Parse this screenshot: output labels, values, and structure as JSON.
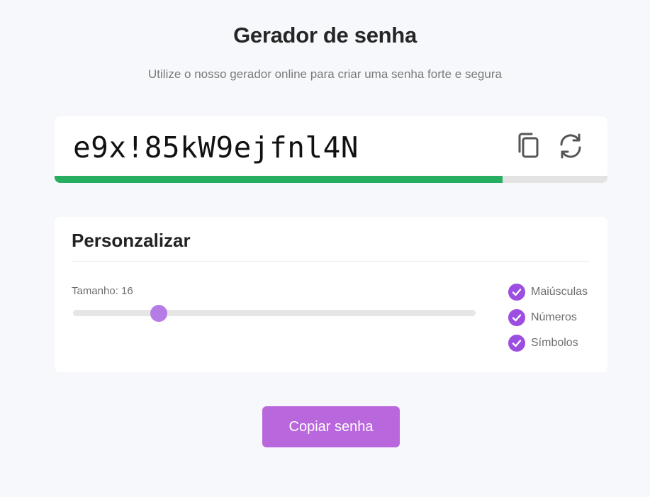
{
  "header": {
    "title": "Gerador de senha",
    "subtitle": "Utilize o nosso gerador online para criar uma senha forte e segura"
  },
  "password": {
    "value": "e9x!85kW9ejfnl4N",
    "strength_fraction": 0.81,
    "strength_color": "#27ae60",
    "copy_icon": "copy-icon",
    "refresh_icon": "refresh-icon"
  },
  "customize": {
    "title": "Personzalizar",
    "length_label": "Tamanho: 16",
    "length_value": 16,
    "options": [
      {
        "label": "Maiúsculas",
        "checked": true
      },
      {
        "label": "Números",
        "checked": true
      },
      {
        "label": "Símbolos",
        "checked": true
      }
    ],
    "accent_color": "#9c4ee0"
  },
  "actions": {
    "copy_button_label": "Copiar senha",
    "button_color": "#b967dc"
  }
}
